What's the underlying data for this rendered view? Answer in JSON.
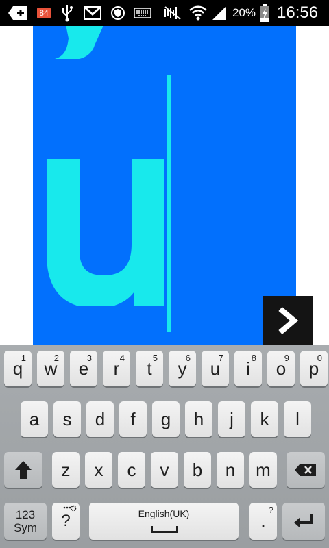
{
  "status_bar": {
    "notification_count": "84",
    "battery_percent": "20%",
    "time": "16:56",
    "icons": [
      "add-icon",
      "notification-badge",
      "usb-icon",
      "gmail-icon",
      "security-icon",
      "keyboard-icon",
      "mute-icon",
      "wifi-icon",
      "signal-icon",
      "battery-charging-icon"
    ]
  },
  "canvas": {
    "background_color": "#0270fd",
    "glyph_color": "#18e9ec",
    "glyph": "ú"
  },
  "next_button": {
    "icon": "chevron-right-icon"
  },
  "keyboard": {
    "row1": [
      {
        "label": "q",
        "hint": "1"
      },
      {
        "label": "w",
        "hint": "2"
      },
      {
        "label": "e",
        "hint": "3"
      },
      {
        "label": "r",
        "hint": "4"
      },
      {
        "label": "t",
        "hint": "5"
      },
      {
        "label": "y",
        "hint": "6"
      },
      {
        "label": "u",
        "hint": "7"
      },
      {
        "label": "i",
        "hint": "8"
      },
      {
        "label": "o",
        "hint": "9"
      },
      {
        "label": "p",
        "hint": "0"
      }
    ],
    "row2": [
      "a",
      "s",
      "d",
      "f",
      "g",
      "h",
      "j",
      "k",
      "l"
    ],
    "row3": [
      "z",
      "x",
      "c",
      "v",
      "b",
      "n",
      "m"
    ],
    "sym_key": "123\nSym",
    "sym_line1": "123",
    "sym_line2": "Sym",
    "question_key": "?",
    "space_label": "English(UK)",
    "period_key": ".",
    "period_hint": "?",
    "icons": [
      "shift-icon",
      "backspace-icon",
      "enter-icon",
      "settings-icon"
    ]
  }
}
